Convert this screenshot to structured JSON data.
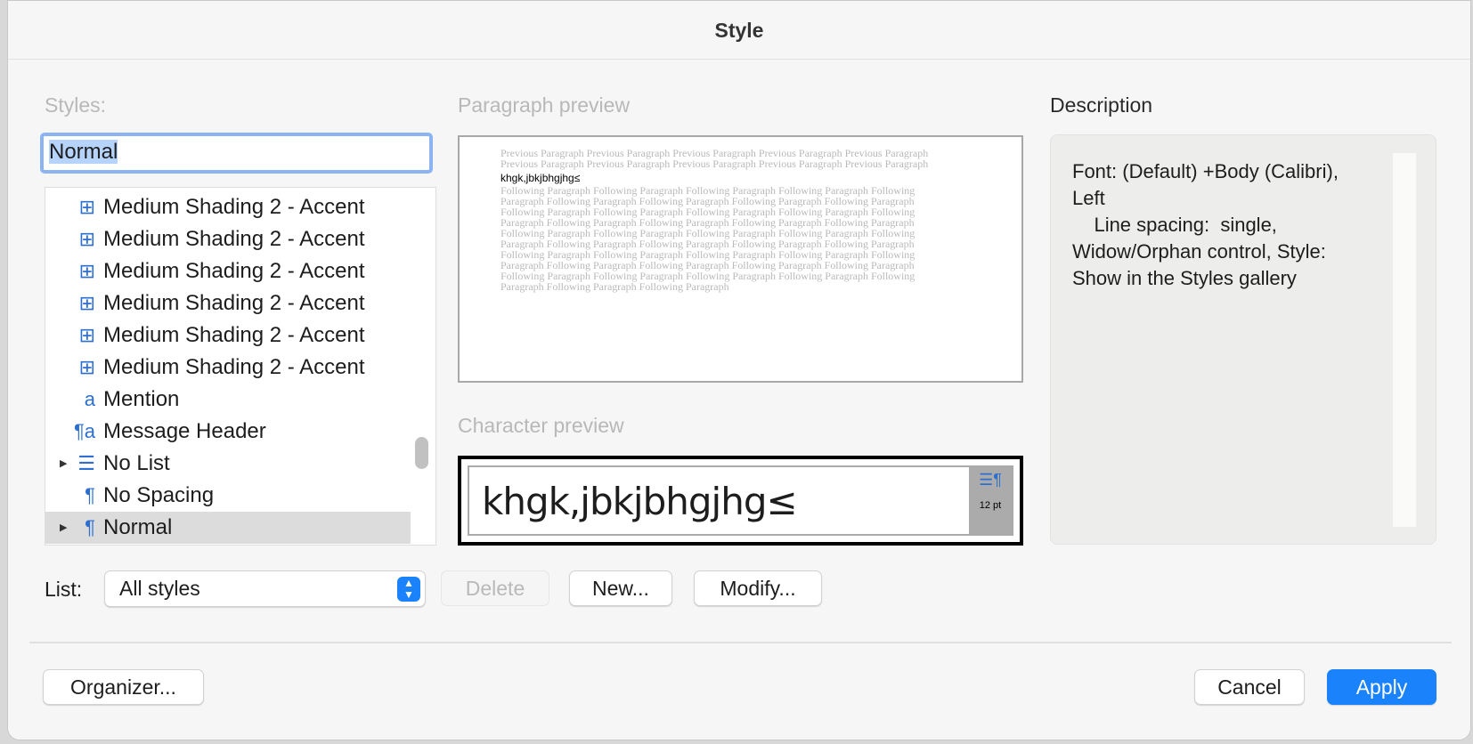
{
  "dialog": {
    "title": "Style"
  },
  "styles": {
    "label": "Styles:",
    "input_value": "Normal",
    "items": [
      {
        "icon": "table-style-icon",
        "glyph": "⊞",
        "label": "Medium Shading 2 - Accent"
      },
      {
        "icon": "table-style-icon",
        "glyph": "⊞",
        "label": "Medium Shading 2 - Accent"
      },
      {
        "icon": "table-style-icon",
        "glyph": "⊞",
        "label": "Medium Shading 2 - Accent"
      },
      {
        "icon": "table-style-icon",
        "glyph": "⊞",
        "label": "Medium Shading 2 - Accent"
      },
      {
        "icon": "table-style-icon",
        "glyph": "⊞",
        "label": "Medium Shading 2 - Accent"
      },
      {
        "icon": "table-style-icon",
        "glyph": "⊞",
        "label": "Medium Shading 2 - Accent"
      },
      {
        "icon": "character-style-icon",
        "glyph": "a",
        "label": "Mention"
      },
      {
        "icon": "linked-style-icon",
        "glyph": "¶a",
        "label": "Message Header"
      },
      {
        "icon": "list-style-icon",
        "glyph": "☰",
        "label": "No List",
        "expandable": true
      },
      {
        "icon": "paragraph-style-icon",
        "glyph": "¶",
        "label": "No Spacing"
      },
      {
        "icon": "paragraph-style-icon",
        "glyph": "¶",
        "label": "Normal",
        "expandable": true,
        "selected": true
      }
    ]
  },
  "paragraph_preview": {
    "label": "Paragraph preview",
    "previous": "Previous Paragraph Previous Paragraph Previous Paragraph Previous Paragraph Previous Paragraph Previous Paragraph Previous Paragraph Previous Paragraph Previous Paragraph Previous Paragraph",
    "current": "khgk,jbkjbhgjhg≤",
    "following": "Following Paragraph Following Paragraph Following Paragraph Following Paragraph Following Paragraph Following Paragraph Following Paragraph Following Paragraph Following Paragraph Following Paragraph Following Paragraph Following Paragraph Following Paragraph Following Paragraph Following Paragraph Following Paragraph Following Paragraph Following Paragraph Following Paragraph Following Paragraph Following Paragraph Following Paragraph Following Paragraph Following Paragraph Following Paragraph Following Paragraph Following Paragraph Following Paragraph Following Paragraph Following Paragraph Following Paragraph Following Paragraph Following Paragraph Following Paragraph Following Paragraph Following Paragraph Following Paragraph Following Paragraph Following Paragraph Following Paragraph Following Paragraph Following Paragraph Following Paragraph"
  },
  "character_preview": {
    "label": "Character preview",
    "text": "khgk,jbkjbhgjhg≤",
    "size": "12 pt",
    "icon": "paragraph-align-icon"
  },
  "description": {
    "label": "Description",
    "text": "Font: (Default) +Body (Calibri), Left\n    Line spacing:  single, Widow/Orphan control, Style: Show in the Styles gallery"
  },
  "list": {
    "label": "List:",
    "selected": "All styles"
  },
  "buttons": {
    "delete": "Delete",
    "new": "New...",
    "modify": "Modify...",
    "organizer": "Organizer...",
    "cancel": "Cancel",
    "apply": "Apply"
  },
  "colors": {
    "accent": "#1a82fb",
    "icon": "#2d6fd0"
  }
}
